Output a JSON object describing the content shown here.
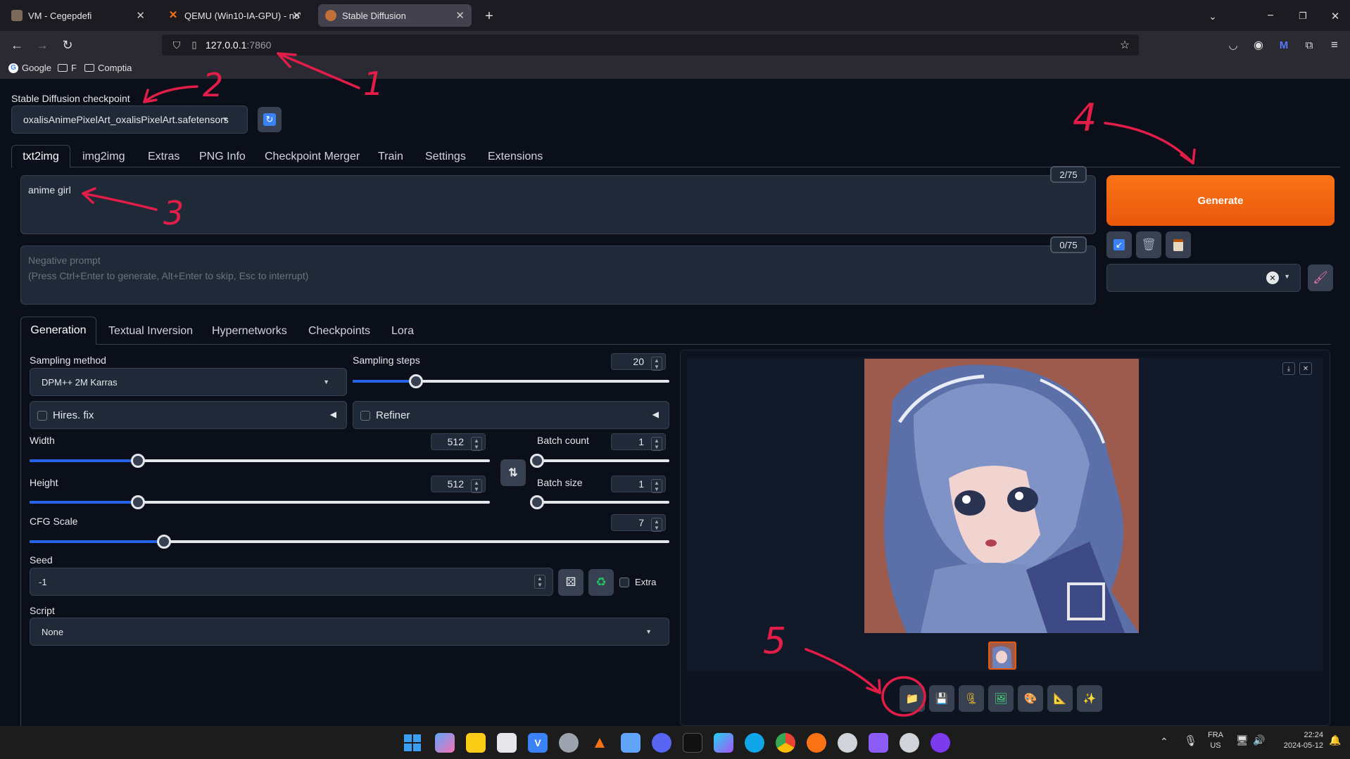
{
  "browser": {
    "tabs": [
      {
        "title": "VM - Cegepdefi"
      },
      {
        "title": "QEMU (Win10-IA-GPU) - noVNC"
      },
      {
        "title": "Stable Diffusion"
      }
    ],
    "new_tab_symbol": "+",
    "url_host": "127.0.0.1",
    "url_port": ":7860",
    "bookmarks": [
      "Google",
      "F",
      "Comptia"
    ]
  },
  "app": {
    "checkpoint_label": "Stable Diffusion checkpoint",
    "checkpoint_value": "oxalisAnimePixelArt_oxalisPixelArt.safetensors",
    "main_tabs": [
      "txt2img",
      "img2img",
      "Extras",
      "PNG Info",
      "Checkpoint Merger",
      "Train",
      "Settings",
      "Extensions"
    ],
    "prompt": "anime girl",
    "prompt_count": "2/75",
    "negative_placeholder_line1": "Negative prompt",
    "negative_placeholder_line2": "(Press Ctrl+Enter to generate, Alt+Enter to skip, Esc to interrupt)",
    "negative_count": "0/75",
    "generate_label": "Generate",
    "sub_tabs": [
      "Generation",
      "Textual Inversion",
      "Hypernetworks",
      "Checkpoints",
      "Lora"
    ],
    "sampling_method_label": "Sampling method",
    "sampling_method_value": "DPM++ 2M Karras",
    "sampling_steps_label": "Sampling steps",
    "sampling_steps_value": "20",
    "hires_label": "Hires. fix",
    "refiner_label": "Refiner",
    "width_label": "Width",
    "width_value": "512",
    "height_label": "Height",
    "height_value": "512",
    "batch_count_label": "Batch count",
    "batch_count_value": "1",
    "batch_size_label": "Batch size",
    "batch_size_value": "1",
    "cfg_label": "CFG Scale",
    "cfg_value": "7",
    "seed_label": "Seed",
    "seed_value": "-1",
    "extra_label": "Extra",
    "script_label": "Script",
    "script_value": "None",
    "sliders": {
      "sampling_steps": 0.2,
      "width": 0.235,
      "height": 0.235,
      "batch_count": 0.0,
      "batch_size": 0.0,
      "cfg": 0.21
    }
  },
  "annotations": [
    "1",
    "2",
    "3",
    "4",
    "5"
  ],
  "taskbar": {
    "lang": "FRA",
    "region": "US",
    "time": "22:24",
    "date": "2024-05-12"
  },
  "colors": {
    "generate": "#ea580c",
    "accent": "#2563eb",
    "annotation": "#e11d48"
  }
}
